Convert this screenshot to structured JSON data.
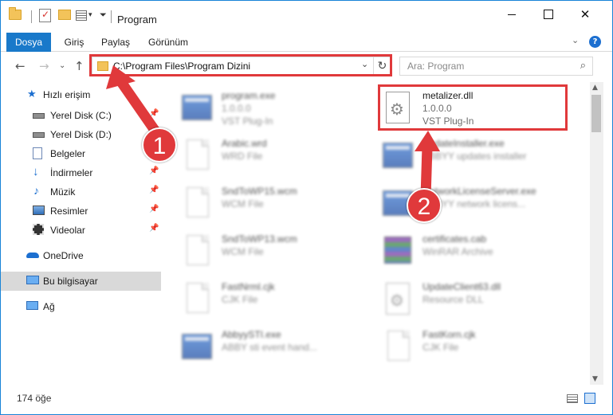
{
  "title_bar": {
    "title": "Program",
    "minimize_icon": "minimize-icon",
    "maximize_icon": "maximize-icon",
    "close_glyph": "✕"
  },
  "ribbon": {
    "tabs": [
      "Dosya",
      "Giriş",
      "Paylaş",
      "Görünüm"
    ],
    "help_glyph": "?"
  },
  "address_bar": {
    "path": "C:\\Program Files\\Program Dizini",
    "search_placeholder": "Ara: Program"
  },
  "sidebar": {
    "items": [
      {
        "label": "Hızlı erişim",
        "icon": "star-icon"
      },
      {
        "label": "Yerel Disk (C:)",
        "icon": "drive-icon"
      },
      {
        "label": "Yerel Disk (D:)",
        "icon": "drive-icon"
      },
      {
        "label": "Belgeler",
        "icon": "documents-icon"
      },
      {
        "label": "İndirmeler",
        "icon": "download-icon"
      },
      {
        "label": "Müzik",
        "icon": "music-icon"
      },
      {
        "label": "Resimler",
        "icon": "pictures-icon"
      },
      {
        "label": "Videolar",
        "icon": "videos-icon"
      },
      {
        "label": "OneDrive",
        "icon": "cloud-icon"
      },
      {
        "label": "Bu bilgisayar",
        "icon": "computer-icon"
      },
      {
        "label": "Ağ",
        "icon": "network-icon"
      }
    ]
  },
  "files": [
    {
      "name": "program.exe",
      "line1": "1.0.0.0",
      "line2": "VST Plug-In",
      "kind": "exe"
    },
    {
      "name": "metalizer.dll",
      "line1": "1.0.0.0",
      "line2": "VST Plug-In",
      "kind": "dll"
    },
    {
      "name": "Arabic.wrd",
      "line1": "WRD File",
      "line2": "",
      "kind": "doc"
    },
    {
      "name": "UpdateInstaller.exe",
      "line1": "ABBYY updates installer",
      "line2": "",
      "kind": "exe"
    },
    {
      "name": "SndToWP15.wcm",
      "line1": "WCM File",
      "line2": "",
      "kind": "doc"
    },
    {
      "name": "NetworkLicenseServer.exe",
      "line1": "ABBYY network licens...",
      "line2": "",
      "kind": "exe"
    },
    {
      "name": "SndToWP13.wcm",
      "line1": "WCM File",
      "line2": "",
      "kind": "doc"
    },
    {
      "name": "certificates.cab",
      "line1": "WinRAR Archive",
      "line2": "",
      "kind": "rar"
    },
    {
      "name": "FastNrml.cjk",
      "line1": "CJK File",
      "line2": "",
      "kind": "doc"
    },
    {
      "name": "UpdateClient63.dll",
      "line1": "Resource DLL",
      "line2": "",
      "kind": "dll"
    },
    {
      "name": "AbbyySTI.exe",
      "line1": "ABBY sti event hand...",
      "line2": "",
      "kind": "exe"
    },
    {
      "name": "FastKorn.cjk",
      "line1": "CJK File",
      "line2": "",
      "kind": "doc"
    }
  ],
  "status_bar": {
    "item_count": "174 öğe"
  },
  "callouts": {
    "one": "1",
    "two": "2",
    "color": "#e0393b"
  }
}
